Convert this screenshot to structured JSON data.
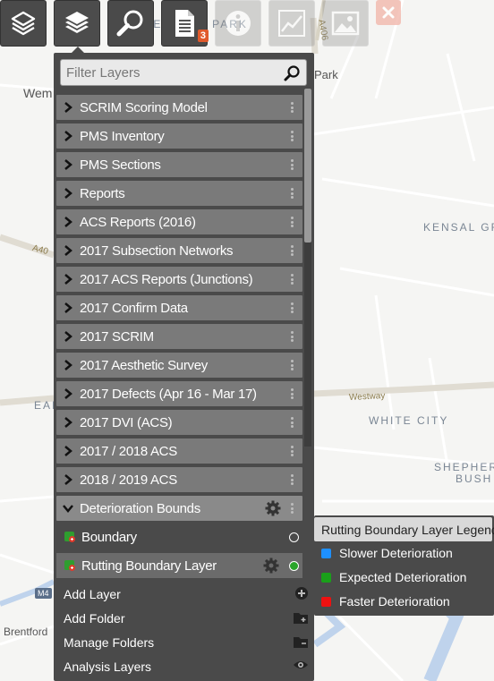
{
  "toolbar": {
    "buttons": [
      {
        "name": "layers-icon"
      },
      {
        "name": "layers-active-icon"
      },
      {
        "name": "search-icon"
      },
      {
        "name": "document-icon",
        "badge": "3"
      },
      {
        "name": "info-icon"
      },
      {
        "name": "chart-icon"
      },
      {
        "name": "image-icon"
      },
      {
        "name": "close-icon"
      }
    ]
  },
  "map": {
    "labels": {
      "wembley_park": "WEMBLEY PARK",
      "wembley": "Wem",
      "park": "Park",
      "kensal": "KENSAL GR",
      "white_city": "WHITE CITY",
      "shepherds": "SHEPHER",
      "bush": "BUSH",
      "ealing": "EAI",
      "westway": "Westway",
      "a40": "A40",
      "a406": "A406",
      "m4": "M4",
      "brentford": "Brentford"
    }
  },
  "panel": {
    "filter_placeholder": "Filter Layers",
    "layers": [
      {
        "label": "SCRIM Scoring Model"
      },
      {
        "label": "PMS Inventory"
      },
      {
        "label": "PMS Sections"
      },
      {
        "label": "Reports"
      },
      {
        "label": "ACS Reports (2016)"
      },
      {
        "label": "2017 Subsection Networks"
      },
      {
        "label": "2017 ACS Reports (Junctions)"
      },
      {
        "label": "2017 Confirm Data"
      },
      {
        "label": "2017 SCRIM"
      },
      {
        "label": "2017 Aesthetic Survey"
      },
      {
        "label": "2017 Defects (Apr 16 - Mar 17)"
      },
      {
        "label": "2017 DVI (ACS)"
      },
      {
        "label": "2017 / 2018 ACS"
      },
      {
        "label": "2018 / 2019 ACS"
      }
    ],
    "expanded_folder": {
      "label": "Deterioration Bounds",
      "children": [
        {
          "label": "Boundary",
          "visible": false
        },
        {
          "label": "Rutting Boundary Layer",
          "visible": true
        }
      ]
    },
    "actions": [
      {
        "label": "Add Layer",
        "icon": "plus-circle-icon"
      },
      {
        "label": "Add Folder",
        "icon": "folder-plus-icon"
      },
      {
        "label": "Manage Folders",
        "icon": "folder-icon"
      },
      {
        "label": "Analysis Layers",
        "icon": "eye-icon"
      }
    ]
  },
  "legend": {
    "title": "Rutting Boundary Layer Legend",
    "items": [
      {
        "label": "Slower Deterioration",
        "color": "#1e90ff"
      },
      {
        "label": "Expected Deterioration",
        "color": "#1aa01a"
      },
      {
        "label": "Faster Deterioration",
        "color": "#ee1111"
      }
    ]
  }
}
